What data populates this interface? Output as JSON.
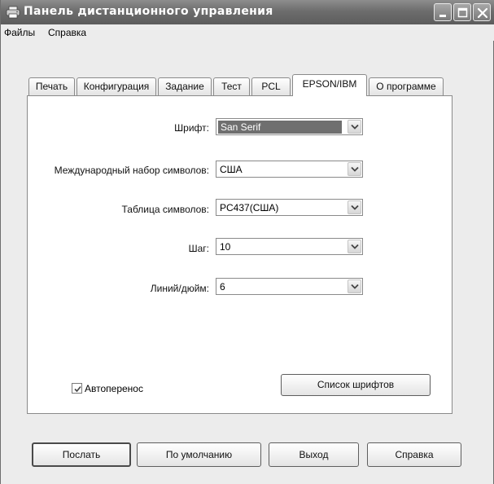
{
  "window": {
    "title": "Панель дистанционного управления"
  },
  "menu": {
    "files": "Файлы",
    "help": "Справка"
  },
  "tabs": [
    {
      "label": "Печать",
      "active": false
    },
    {
      "label": "Конфигурация",
      "active": false
    },
    {
      "label": "Задание",
      "active": false
    },
    {
      "label": "Тест",
      "active": false
    },
    {
      "label": "PCL",
      "active": false
    },
    {
      "label": "EPSON/IBM",
      "active": true
    },
    {
      "label": "О программе",
      "active": false
    }
  ],
  "form": {
    "font": {
      "label": "Шрифт:",
      "value": "San Serif"
    },
    "charset": {
      "label": "Международный набор символов:",
      "value": "США"
    },
    "codetable": {
      "label": "Таблица символов:",
      "value": "PC437(США)"
    },
    "pitch": {
      "label": "Шаг:",
      "value": "10"
    },
    "lpi": {
      "label": "Линий/дюйм:",
      "value": "6"
    },
    "autowrap": {
      "label": "Автоперенос",
      "checked": true
    },
    "font_list_button": "Список шрифтов"
  },
  "buttons": {
    "send": "Послать",
    "defaults": "По умолчанию",
    "exit": "Выход",
    "help": "Справка"
  },
  "icons": {
    "app": "printer-icon",
    "minimize": "minimize-icon",
    "maximize": "maximize-icon",
    "close": "close-icon",
    "dropdown": "chevron-down-icon",
    "check": "check-icon"
  }
}
